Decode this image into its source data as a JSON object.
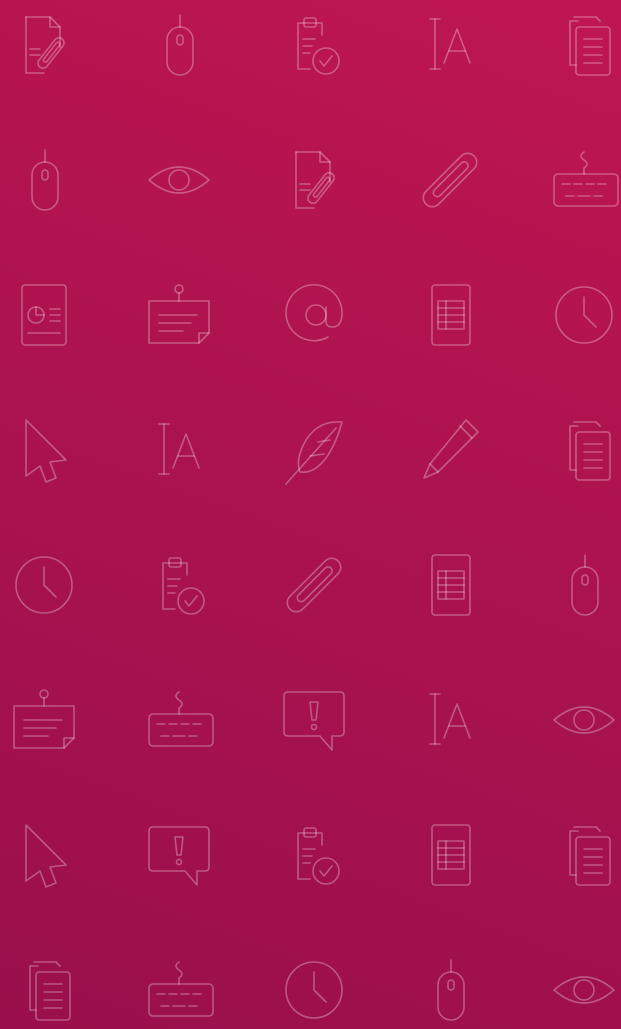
{
  "background": {
    "gradient_top": "#bf1651",
    "gradient_bottom": "#9a0f4b",
    "icon_stroke": "rgba(255,255,255,0.30)"
  },
  "icon_grid": [
    [
      "attachment-document-icon",
      "mouse-icon",
      "clipboard-check-icon",
      "text-cursor-icon",
      "copy-documents-icon"
    ],
    [
      "mouse-icon",
      "eye-icon",
      "attachment-document-icon",
      "paperclip-icon",
      "keyboard-icon"
    ],
    [
      "report-document-icon",
      "pinned-note-icon",
      "at-sign-icon",
      "spreadsheet-icon",
      "clock-icon"
    ],
    [
      "cursor-pointer-icon",
      "text-cursor-icon",
      "feather-icon",
      "pencil-icon",
      "copy-documents-icon"
    ],
    [
      "clock-icon",
      "clipboard-check-icon",
      "paperclip-icon",
      "spreadsheet-icon",
      "mouse-icon"
    ],
    [
      "pinned-note-icon",
      "keyboard-icon",
      "alert-message-icon",
      "text-cursor-icon",
      "eye-icon"
    ],
    [
      "cursor-pointer-icon",
      "alert-message-icon",
      "clipboard-check-icon",
      "spreadsheet-icon",
      "copy-documents-icon"
    ],
    [
      "copy-documents-icon",
      "keyboard-icon",
      "clock-icon",
      "mouse-icon",
      "eye-icon"
    ]
  ]
}
